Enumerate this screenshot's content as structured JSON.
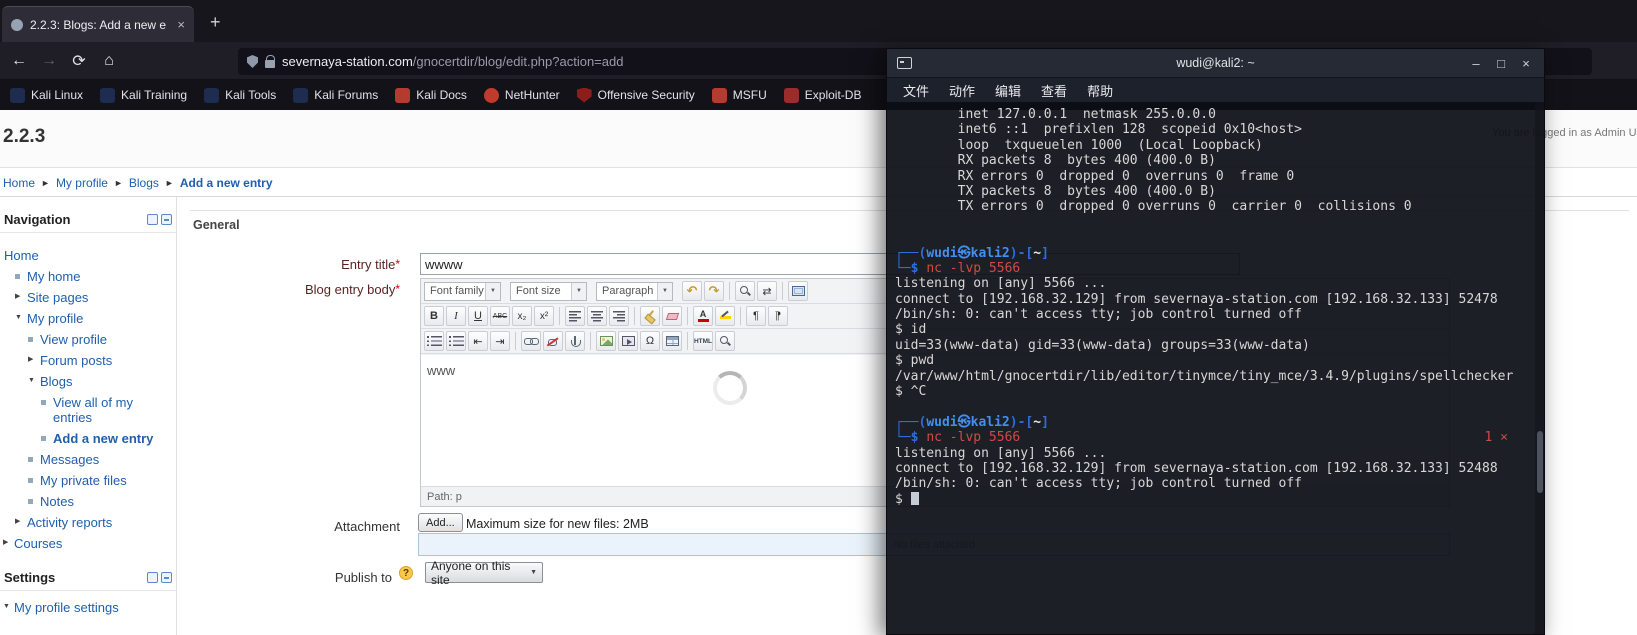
{
  "browser": {
    "tab": {
      "title": "2.2.3: Blogs: Add a new e",
      "close_glyph": "×"
    },
    "new_tab_glyph": "+",
    "nav": {
      "back_glyph": "←",
      "forward_glyph": "→",
      "reload_glyph": "⟳",
      "home_glyph": "⌂"
    },
    "url": {
      "domain": "severnaya-station.com",
      "path": "/gnocertdir/blog/edit.php?action=add"
    },
    "bookmarks": [
      {
        "label": "Kali Linux",
        "icon": "kali-dragon-icon",
        "color": "#1d2c4f"
      },
      {
        "label": "Kali Training",
        "icon": "kali-dragon-icon",
        "color": "#1d2c4f"
      },
      {
        "label": "Kali Tools",
        "icon": "kali-dragon-icon",
        "color": "#1d2c4f"
      },
      {
        "label": "Kali Forums",
        "icon": "kali-dragon-icon",
        "color": "#1d2c4f"
      },
      {
        "label": "Kali Docs",
        "icon": "kali-docs-icon",
        "color": "#b63a2f"
      },
      {
        "label": "NetHunter",
        "icon": "nethunter-icon",
        "color": "#c03b2e",
        "shape": "circle"
      },
      {
        "label": "Offensive Security",
        "icon": "offensive-security-icon",
        "color": "#8c1d1d",
        "shape": "shield-shape"
      },
      {
        "label": "MSFU",
        "icon": "msfu-icon",
        "color": "#b63a2f"
      },
      {
        "label": "Exploit-DB",
        "icon": "exploit-db-icon",
        "color": "#9c2b2b"
      }
    ]
  },
  "page": {
    "heading": "2.2.3",
    "logged_in": "You are logged in as Admin User (Logout)",
    "breadcrumb": [
      "Home",
      "My profile",
      "Blogs",
      "Add a new entry"
    ],
    "breadcrumb_separator": "►",
    "nav_block": {
      "title": "Navigation",
      "items": [
        {
          "label": "Home",
          "depth": 0,
          "marker": "none"
        },
        {
          "label": "My home",
          "depth": 1,
          "marker": "bullet"
        },
        {
          "label": "Site pages",
          "depth": 1,
          "marker": "tri-r"
        },
        {
          "label": "My profile",
          "depth": 1,
          "marker": "tri-d"
        },
        {
          "label": "View profile",
          "depth": 2,
          "marker": "bullet"
        },
        {
          "label": "Forum posts",
          "depth": 2,
          "marker": "tri-r"
        },
        {
          "label": "Blogs",
          "depth": 2,
          "marker": "tri-d"
        },
        {
          "label": "View all of my entries",
          "depth": 3,
          "marker": "bullet"
        },
        {
          "label": "Add a new entry",
          "depth": 3,
          "marker": "bullet",
          "bold": true
        },
        {
          "label": "Messages",
          "depth": 2,
          "marker": "bullet"
        },
        {
          "label": "My private files",
          "depth": 2,
          "marker": "bullet"
        },
        {
          "label": "Notes",
          "depth": 2,
          "marker": "bullet"
        },
        {
          "label": "Activity reports",
          "depth": 1,
          "marker": "tri-r"
        },
        {
          "label": "Courses",
          "depth": 0,
          "marker": "tri-r"
        }
      ]
    },
    "settings_block": {
      "title": "Settings",
      "items": [
        {
          "label": "My profile settings",
          "depth": 0,
          "marker": "tri-d"
        }
      ]
    },
    "form": {
      "section": "General",
      "required_mark": "*",
      "entry_title_label": "Entry title",
      "entry_title_value": "wwww",
      "body_label": "Blog entry body",
      "attachment_label": "Attachment",
      "add_button": "Add...",
      "max_size": "Maximum size for new files: 2MB",
      "no_files": "No files attached",
      "publish_label": "Publish to",
      "publish_help": "?",
      "publish_value": "Anyone on this site",
      "publish_arrow": "▼",
      "editor": {
        "content": "www",
        "path": "Path: p",
        "toolbar1": [
          {
            "select": true,
            "name": "font-family-select",
            "label": "Font family"
          },
          {
            "select": true,
            "name": "font-size-select",
            "label": "Font size"
          },
          {
            "select": true,
            "name": "format-select",
            "label": "Paragraph"
          },
          {
            "name": "undo-icon",
            "g": "↶",
            "cls": "s-gold"
          },
          {
            "name": "redo-icon",
            "g": "↷",
            "cls": "s-gold"
          },
          {
            "sep": true
          },
          {
            "name": "search-icon",
            "cls": "sh-mag"
          },
          {
            "name": "find-replace-icon",
            "g": "⇄"
          },
          {
            "sep": true
          },
          {
            "name": "fullscreen-icon",
            "cls": "sh-fullscreen"
          }
        ],
        "toolbar2": [
          {
            "name": "bold-icon",
            "g": "B",
            "cls": "s-bold"
          },
          {
            "name": "italic-icon",
            "g": "I",
            "cls": "s-italic"
          },
          {
            "name": "underline-icon",
            "g": "U",
            "cls": "s-under"
          },
          {
            "name": "strikethrough-icon",
            "g": "ABC",
            "cls": "s-strike"
          },
          {
            "name": "subscript-icon",
            "g": "x₂",
            "cls": "s-small"
          },
          {
            "name": "superscript-icon",
            "g": "x²",
            "cls": "s-small"
          },
          {
            "sep": true
          },
          {
            "name": "align-left-icon",
            "cls": "sh-alignl"
          },
          {
            "name": "align-center-icon",
            "cls": "sh-alignc"
          },
          {
            "name": "align-right-icon",
            "cls": "sh-alignr"
          },
          {
            "sep": true
          },
          {
            "name": "cleanup-icon",
            "cls": "sh-cleanup"
          },
          {
            "name": "remove-format-icon",
            "cls": "sh-eraser"
          },
          {
            "sep": true
          },
          {
            "name": "font-color-icon",
            "cls": "ic-A"
          },
          {
            "name": "highlight-color-icon",
            "cls": "ic-pen"
          },
          {
            "sep": true
          },
          {
            "name": "ltr-icon",
            "g": "¶"
          },
          {
            "name": "rtl-icon",
            "g": "¶",
            "cls": "s-flip"
          }
        ],
        "toolbar3": [
          {
            "name": "bullet-list-icon",
            "cls": "sh-bullist"
          },
          {
            "name": "numbered-list-icon",
            "cls": "sh-numlist"
          },
          {
            "name": "outdent-icon",
            "g": "⇤"
          },
          {
            "name": "indent-icon",
            "g": "⇥"
          },
          {
            "sep": true
          },
          {
            "name": "link-icon",
            "cls": "sh-link"
          },
          {
            "name": "unlink-icon",
            "cls": "sh-unlink"
          },
          {
            "name": "anchor-icon",
            "cls": "sh-anchor"
          },
          {
            "sep": true
          },
          {
            "name": "image-icon",
            "cls": "sh-image"
          },
          {
            "name": "media-icon",
            "cls": "sh-media"
          },
          {
            "name": "special-char-icon",
            "g": "Ω"
          },
          {
            "name": "table-icon",
            "cls": "sh-table"
          },
          {
            "sep": true
          },
          {
            "name": "html-code-icon",
            "g": "HTML",
            "cls": "s-html"
          },
          {
            "name": "preview-icon",
            "cls": "sh-mag"
          }
        ]
      }
    }
  },
  "terminal": {
    "title": "wudi@kali2: ~",
    "controls": {
      "minimize": "–",
      "maximize": "□",
      "close": "×"
    },
    "menu": [
      "文件",
      "动作",
      "编辑",
      "查看",
      "帮助"
    ],
    "lines": [
      {
        "s": [
          [
            "        inet 127.0.0.1  netmask 255.0.0.0",
            "w"
          ]
        ]
      },
      {
        "s": [
          [
            "        inet6 ::1  prefixlen 128  scopeid 0x10<host>",
            "w"
          ]
        ]
      },
      {
        "s": [
          [
            "        loop  txqueuelen 1000  (Local Loopback)",
            "w"
          ]
        ]
      },
      {
        "s": [
          [
            "        RX packets 8  bytes 400 (400.0 B)",
            "w"
          ]
        ]
      },
      {
        "s": [
          [
            "        RX errors 0  dropped 0  overruns 0  frame 0",
            "w"
          ]
        ]
      },
      {
        "s": [
          [
            "        TX packets 8  bytes 400 (400.0 B)",
            "w"
          ]
        ]
      },
      {
        "s": [
          [
            "        TX errors 0  dropped 0 overruns 0  carrier 0  collisions 0",
            "w"
          ]
        ]
      },
      {
        "s": []
      },
      {
        "s": []
      },
      {
        "s": [
          [
            "┌──(",
            "b"
          ],
          [
            "wudi㉿kali2",
            "u"
          ],
          [
            ")-[",
            "b"
          ],
          [
            "~",
            "wb"
          ],
          [
            "]",
            "b"
          ]
        ]
      },
      {
        "s": [
          [
            "└─$ ",
            "b"
          ],
          [
            "nc -lvp 5566",
            "r"
          ]
        ]
      },
      {
        "s": [
          [
            "listening on [any] 5566 ...",
            "w"
          ]
        ]
      },
      {
        "s": [
          [
            "connect to [192.168.32.129] from severnaya-station.com [192.168.32.133] 52478",
            "w"
          ]
        ]
      },
      {
        "s": [
          [
            "/bin/sh: 0: can't access tty; job control turned off",
            "w"
          ]
        ]
      },
      {
        "s": [
          [
            "$ id",
            "w"
          ]
        ]
      },
      {
        "s": [
          [
            "uid=33(www-data) gid=33(www-data) groups=33(www-data)",
            "w"
          ]
        ]
      },
      {
        "s": [
          [
            "$ pwd",
            "w"
          ]
        ]
      },
      {
        "s": [
          [
            "/var/www/html/gnocertdir/lib/editor/tinymce/tiny_mce/3.4.9/plugins/spellchecker",
            "w"
          ]
        ]
      },
      {
        "s": [
          [
            "$ ^C",
            "w"
          ]
        ]
      },
      {
        "s": []
      },
      {
        "s": [
          [
            "┌──(",
            "b"
          ],
          [
            "wudi㉿kali2",
            "u"
          ],
          [
            ")-[",
            "b"
          ],
          [
            "~",
            "wb"
          ],
          [
            "]",
            "b"
          ]
        ]
      },
      {
        "s": [
          [
            "└─$ ",
            "b"
          ],
          [
            "nc -lvp 5566",
            "r"
          ]
        ],
        "right": "1 ⨯"
      },
      {
        "s": [
          [
            "listening on [any] 5566 ...",
            "w"
          ]
        ]
      },
      {
        "s": [
          [
            "connect to [192.168.32.129] from severnaya-station.com [192.168.32.133] 52488",
            "w"
          ]
        ]
      },
      {
        "s": [
          [
            "/bin/sh: 0: can't access tty; job control turned off",
            "w"
          ]
        ]
      },
      {
        "s": [
          [
            "$ ",
            "w"
          ]
        ],
        "cursor": true
      }
    ]
  }
}
